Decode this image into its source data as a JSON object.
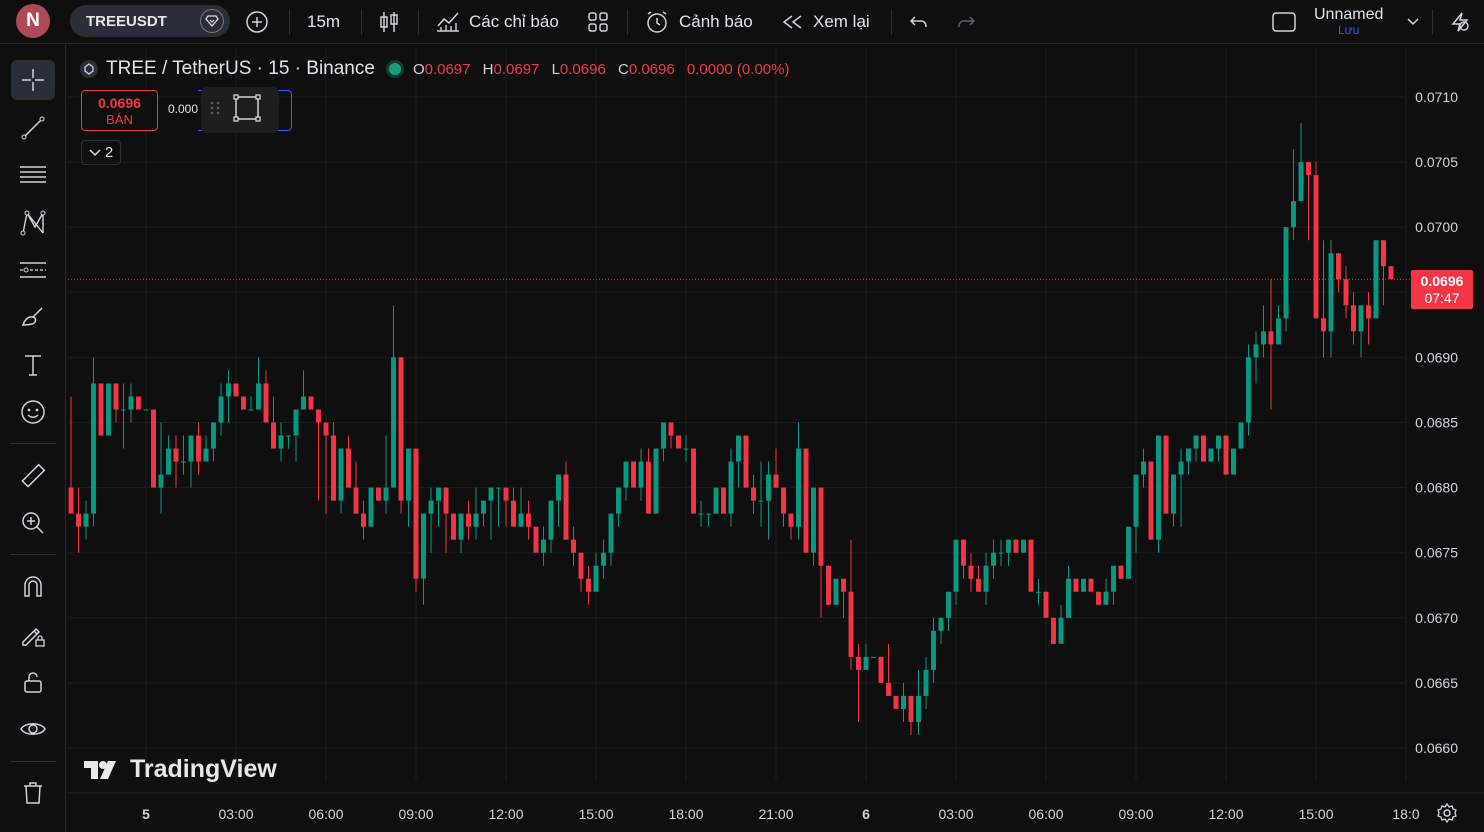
{
  "topbar": {
    "avatar_letter": "N",
    "symbol": "TREEUSDT",
    "interval": "15m",
    "indicators_label": "Các chỉ báo",
    "alerts_label": "Cảnh báo",
    "replay_label": "Xem lại",
    "layout_name": "Unnamed",
    "save_label": "Lưu"
  },
  "legend": {
    "title": "TREE / TetherUS · 15 · Binance",
    "o_key": "O",
    "o_val": "0.0697",
    "h_key": "H",
    "h_val": "0.0697",
    "l_key": "L",
    "l_val": "0.0696",
    "c_key": "C",
    "c_val": "0.0696",
    "change": "0.0000 (0.00%)"
  },
  "trade": {
    "sell_price": "0.0696",
    "sell_label": "BÁN",
    "spread": "0.000",
    "indicators_collapsed_count": "2"
  },
  "branding": {
    "logo_text": "TradingView"
  },
  "current_price": {
    "price": "0.0696",
    "countdown": "07:47"
  },
  "colors": {
    "up": "#089981",
    "down": "#f23645",
    "background": "#0f0f0f",
    "grid": "#1c1c1c",
    "accent": "#2962ff"
  },
  "left_tools": [
    "crosshair-icon",
    "trend-line-icon",
    "fib-levels-icon",
    "xabcd-pattern-icon",
    "forecast-icon",
    "brush-icon",
    "text-icon",
    "emoji-icon",
    "ruler-icon",
    "zoom-in-icon",
    "magnet-icon",
    "lock-drawing-icon",
    "lock-icon",
    "eye-icon",
    "trash-icon"
  ],
  "chart_data": {
    "type": "candlestick",
    "y_ticks": [
      "0.0710",
      "0.0705",
      "0.0700",
      "0.0695",
      "0.0690",
      "0.0685",
      "0.0680",
      "0.0675",
      "0.0670",
      "0.0665",
      "0.0660"
    ],
    "ylim": [
      0.06575,
      0.07135
    ],
    "x_ticks": [
      "5",
      "03:00",
      "06:00",
      "09:00",
      "12:00",
      "15:00",
      "18:00",
      "21:00",
      "6",
      "03:00",
      "06:00",
      "09:00",
      "12:00",
      "15:00",
      "18:0"
    ],
    "x_tick_hours_from_start": [
      0,
      3,
      6,
      9,
      12,
      15,
      18,
      21,
      24,
      27,
      30,
      33,
      36,
      39,
      42
    ],
    "bar_interval_minutes": 15,
    "first_bar_hours_offset": -2.5,
    "ohlc": [
      [
        0.068,
        0.0687,
        0.0678,
        0.0678
      ],
      [
        0.0678,
        0.068,
        0.0675,
        0.0677
      ],
      [
        0.0677,
        0.0679,
        0.0676,
        0.0678
      ],
      [
        0.0678,
        0.069,
        0.0677,
        0.0688
      ],
      [
        0.0688,
        0.0688,
        0.0684,
        0.0684
      ],
      [
        0.0684,
        0.0688,
        0.0684,
        0.0688
      ],
      [
        0.0688,
        0.0688,
        0.0685,
        0.0686
      ],
      [
        0.0686,
        0.0688,
        0.0683,
        0.0686
      ],
      [
        0.0686,
        0.0688,
        0.0685,
        0.0687
      ],
      [
        0.0687,
        0.0687,
        0.0686,
        0.0686
      ],
      [
        0.0686,
        0.0686,
        0.0686,
        0.0686
      ],
      [
        0.0686,
        0.0686,
        0.068,
        0.068
      ],
      [
        0.068,
        0.0685,
        0.0678,
        0.0681
      ],
      [
        0.0681,
        0.0684,
        0.0681,
        0.0683
      ],
      [
        0.0683,
        0.0684,
        0.068,
        0.0682
      ],
      [
        0.0682,
        0.0684,
        0.0681,
        0.0682
      ],
      [
        0.0682,
        0.0684,
        0.068,
        0.0684
      ],
      [
        0.0684,
        0.0685,
        0.0681,
        0.0682
      ],
      [
        0.0682,
        0.0684,
        0.0682,
        0.0683
      ],
      [
        0.0683,
        0.0685,
        0.0682,
        0.0685
      ],
      [
        0.0685,
        0.0688,
        0.0684,
        0.0687
      ],
      [
        0.0687,
        0.0689,
        0.0685,
        0.0688
      ],
      [
        0.0688,
        0.0687,
        0.0687,
        0.0687
      ],
      [
        0.0687,
        0.0687,
        0.0686,
        0.0686
      ],
      [
        0.0686,
        0.0687,
        0.0686,
        0.0686
      ],
      [
        0.0686,
        0.069,
        0.0686,
        0.0688
      ],
      [
        0.0688,
        0.0689,
        0.0685,
        0.0685
      ],
      [
        0.0685,
        0.0687,
        0.0683,
        0.0683
      ],
      [
        0.0683,
        0.0685,
        0.0682,
        0.0684
      ],
      [
        0.0684,
        0.0684,
        0.0683,
        0.0684
      ],
      [
        0.0684,
        0.0686,
        0.0682,
        0.0686
      ],
      [
        0.0686,
        0.0689,
        0.0686,
        0.0687
      ],
      [
        0.0687,
        0.0687,
        0.0686,
        0.0686
      ],
      [
        0.0686,
        0.0686,
        0.0679,
        0.0685
      ],
      [
        0.0685,
        0.0684,
        0.0678,
        0.0684
      ],
      [
        0.0684,
        0.0685,
        0.0679,
        0.0679
      ],
      [
        0.0679,
        0.0683,
        0.0678,
        0.0683
      ],
      [
        0.0683,
        0.0684,
        0.068,
        0.068
      ],
      [
        0.068,
        0.0682,
        0.0678,
        0.0678
      ],
      [
        0.0678,
        0.0679,
        0.0676,
        0.0677
      ],
      [
        0.0677,
        0.068,
        0.0677,
        0.068
      ],
      [
        0.068,
        0.0679,
        0.0679,
        0.0679
      ],
      [
        0.0679,
        0.0684,
        0.0678,
        0.068
      ],
      [
        0.068,
        0.0694,
        0.068,
        0.069
      ],
      [
        0.069,
        0.0689,
        0.0678,
        0.0679
      ],
      [
        0.0679,
        0.0683,
        0.0677,
        0.0683
      ],
      [
        0.0683,
        0.0678,
        0.0672,
        0.0673
      ],
      [
        0.0673,
        0.0678,
        0.0671,
        0.0678
      ],
      [
        0.0678,
        0.068,
        0.0675,
        0.0679
      ],
      [
        0.0679,
        0.068,
        0.0677,
        0.068
      ],
      [
        0.068,
        0.0679,
        0.0675,
        0.0678
      ],
      [
        0.0678,
        0.0678,
        0.0676,
        0.0676
      ],
      [
        0.0676,
        0.0678,
        0.0675,
        0.0678
      ],
      [
        0.0678,
        0.0679,
        0.0676,
        0.0677
      ],
      [
        0.0677,
        0.068,
        0.0676,
        0.0678
      ],
      [
        0.0678,
        0.0679,
        0.0677,
        0.0679
      ],
      [
        0.0679,
        0.068,
        0.0676,
        0.068
      ],
      [
        0.068,
        0.068,
        0.0677,
        0.068
      ],
      [
        0.068,
        0.068,
        0.0677,
        0.0679
      ],
      [
        0.0679,
        0.068,
        0.0677,
        0.0677
      ],
      [
        0.0677,
        0.068,
        0.0677,
        0.0678
      ],
      [
        0.0678,
        0.0679,
        0.0676,
        0.0677
      ],
      [
        0.0677,
        0.0676,
        0.0675,
        0.0675
      ],
      [
        0.0675,
        0.0677,
        0.0674,
        0.0676
      ],
      [
        0.0676,
        0.0679,
        0.0675,
        0.0679
      ],
      [
        0.0679,
        0.0681,
        0.0677,
        0.0681
      ],
      [
        0.0681,
        0.0682,
        0.0676,
        0.0676
      ],
      [
        0.0676,
        0.0677,
        0.0674,
        0.0675
      ],
      [
        0.0675,
        0.0674,
        0.0672,
        0.0673
      ],
      [
        0.0673,
        0.0674,
        0.0671,
        0.0672
      ],
      [
        0.0672,
        0.0675,
        0.0672,
        0.0674
      ],
      [
        0.0674,
        0.0676,
        0.0673,
        0.0675
      ],
      [
        0.0675,
        0.0678,
        0.0674,
        0.0678
      ],
      [
        0.0678,
        0.068,
        0.0677,
        0.068
      ],
      [
        0.068,
        0.0682,
        0.0679,
        0.0682
      ],
      [
        0.0682,
        0.0682,
        0.068,
        0.068
      ],
      [
        0.068,
        0.0683,
        0.0679,
        0.0682
      ],
      [
        0.0682,
        0.0683,
        0.0678,
        0.0678
      ],
      [
        0.0678,
        0.0683,
        0.0678,
        0.0683
      ],
      [
        0.0683,
        0.0685,
        0.0682,
        0.0685
      ],
      [
        0.0685,
        0.0685,
        0.0683,
        0.0684
      ],
      [
        0.0684,
        0.0684,
        0.0683,
        0.0683
      ],
      [
        0.0683,
        0.0684,
        0.0682,
        0.0683
      ],
      [
        0.0683,
        0.0683,
        0.0678,
        0.0678
      ],
      [
        0.0678,
        0.0679,
        0.0677,
        0.0678
      ],
      [
        0.0678,
        0.0678,
        0.0677,
        0.0678
      ],
      [
        0.0678,
        0.068,
        0.0678,
        0.068
      ],
      [
        0.068,
        0.068,
        0.0678,
        0.0678
      ],
      [
        0.0678,
        0.0683,
        0.0677,
        0.0682
      ],
      [
        0.0682,
        0.0684,
        0.068,
        0.0684
      ],
      [
        0.0684,
        0.0684,
        0.068,
        0.068
      ],
      [
        0.068,
        0.0681,
        0.0678,
        0.0679
      ],
      [
        0.0679,
        0.0682,
        0.0677,
        0.0679
      ],
      [
        0.0679,
        0.0682,
        0.0676,
        0.0681
      ],
      [
        0.0681,
        0.0683,
        0.068,
        0.068
      ],
      [
        0.068,
        0.068,
        0.0677,
        0.0678
      ],
      [
        0.0678,
        0.0677,
        0.0676,
        0.0677
      ],
      [
        0.0677,
        0.0685,
        0.0676,
        0.0683
      ],
      [
        0.0683,
        0.0683,
        0.0675,
        0.0675
      ],
      [
        0.0675,
        0.068,
        0.0674,
        0.068
      ],
      [
        0.068,
        0.0678,
        0.067,
        0.0674
      ],
      [
        0.0674,
        0.0674,
        0.0671,
        0.0671
      ],
      [
        0.0671,
        0.0673,
        0.0671,
        0.0673
      ],
      [
        0.0673,
        0.0672,
        0.067,
        0.0672
      ],
      [
        0.0672,
        0.0676,
        0.0666,
        0.0667
      ],
      [
        0.0667,
        0.0668,
        0.0662,
        0.0666
      ],
      [
        0.0666,
        0.0668,
        0.0666,
        0.0667
      ],
      [
        0.0667,
        0.0667,
        0.0667,
        0.0667
      ],
      [
        0.0667,
        0.0667,
        0.0665,
        0.0665
      ],
      [
        0.0665,
        0.0668,
        0.0664,
        0.0664
      ],
      [
        0.0664,
        0.0664,
        0.0663,
        0.0663
      ],
      [
        0.0663,
        0.0665,
        0.0662,
        0.0664
      ],
      [
        0.0664,
        0.0664,
        0.0661,
        0.0662
      ],
      [
        0.0662,
        0.0666,
        0.0661,
        0.0664
      ],
      [
        0.0664,
        0.0667,
        0.0663,
        0.0666
      ],
      [
        0.0666,
        0.067,
        0.0665,
        0.0669
      ],
      [
        0.0669,
        0.067,
        0.0668,
        0.067
      ],
      [
        0.067,
        0.0672,
        0.0669,
        0.0672
      ],
      [
        0.0672,
        0.0676,
        0.0671,
        0.0676
      ],
      [
        0.0676,
        0.0676,
        0.0673,
        0.0674
      ],
      [
        0.0674,
        0.0675,
        0.0672,
        0.0673
      ],
      [
        0.0673,
        0.0674,
        0.0672,
        0.0672
      ],
      [
        0.0672,
        0.0675,
        0.0671,
        0.0674
      ],
      [
        0.0674,
        0.0676,
        0.0673,
        0.0675
      ],
      [
        0.0675,
        0.0676,
        0.0674,
        0.0675
      ],
      [
        0.0675,
        0.0676,
        0.0674,
        0.0676
      ],
      [
        0.0676,
        0.0676,
        0.0675,
        0.0675
      ],
      [
        0.0675,
        0.0676,
        0.0675,
        0.0676
      ],
      [
        0.0676,
        0.0676,
        0.0672,
        0.0672
      ],
      [
        0.0672,
        0.0673,
        0.0671,
        0.0672
      ],
      [
        0.0672,
        0.0672,
        0.067,
        0.067
      ],
      [
        0.067,
        0.067,
        0.0668,
        0.0668
      ],
      [
        0.0668,
        0.0671,
        0.0668,
        0.067
      ],
      [
        0.067,
        0.0674,
        0.067,
        0.0673
      ],
      [
        0.0673,
        0.0673,
        0.0672,
        0.0672
      ],
      [
        0.0672,
        0.0673,
        0.0672,
        0.0673
      ],
      [
        0.0673,
        0.0672,
        0.0672,
        0.0672
      ],
      [
        0.0672,
        0.0672,
        0.0671,
        0.0671
      ],
      [
        0.0671,
        0.0673,
        0.0671,
        0.0672
      ],
      [
        0.0672,
        0.0674,
        0.0671,
        0.0674
      ],
      [
        0.0674,
        0.0674,
        0.0673,
        0.0673
      ],
      [
        0.0673,
        0.0677,
        0.0673,
        0.0677
      ],
      [
        0.0677,
        0.0681,
        0.0675,
        0.0681
      ],
      [
        0.0681,
        0.0683,
        0.068,
        0.0682
      ],
      [
        0.0682,
        0.0682,
        0.0676,
        0.0676
      ],
      [
        0.0676,
        0.0684,
        0.0675,
        0.0684
      ],
      [
        0.0684,
        0.0684,
        0.0678,
        0.0678
      ],
      [
        0.0678,
        0.0681,
        0.0677,
        0.0681
      ],
      [
        0.0681,
        0.0683,
        0.0677,
        0.0682
      ],
      [
        0.0682,
        0.0683,
        0.0681,
        0.0683
      ],
      [
        0.0683,
        0.0684,
        0.0682,
        0.0684
      ],
      [
        0.0684,
        0.0684,
        0.0682,
        0.0682
      ],
      [
        0.0682,
        0.0683,
        0.0682,
        0.0683
      ],
      [
        0.0683,
        0.0684,
        0.0682,
        0.0684
      ],
      [
        0.0684,
        0.0684,
        0.0681,
        0.0681
      ],
      [
        0.0681,
        0.0683,
        0.0681,
        0.0683
      ],
      [
        0.0683,
        0.0685,
        0.0683,
        0.0685
      ],
      [
        0.0685,
        0.0691,
        0.0684,
        0.069
      ],
      [
        0.069,
        0.0692,
        0.0688,
        0.0691
      ],
      [
        0.0691,
        0.0694,
        0.069,
        0.0692
      ],
      [
        0.0692,
        0.0696,
        0.0686,
        0.0691
      ],
      [
        0.0691,
        0.0694,
        0.0691,
        0.0693
      ],
      [
        0.0693,
        0.07,
        0.0692,
        0.07
      ],
      [
        0.07,
        0.0706,
        0.0699,
        0.0702
      ],
      [
        0.0702,
        0.0708,
        0.0703,
        0.0705
      ],
      [
        0.0705,
        0.0705,
        0.0699,
        0.0704
      ],
      [
        0.0704,
        0.0705,
        0.0693,
        0.0693
      ],
      [
        0.0693,
        0.0699,
        0.069,
        0.0692
      ],
      [
        0.0692,
        0.0699,
        0.069,
        0.0698
      ],
      [
        0.0698,
        0.0698,
        0.0695,
        0.0696
      ],
      [
        0.0696,
        0.0697,
        0.0693,
        0.0694
      ],
      [
        0.0694,
        0.0695,
        0.0691,
        0.0692
      ],
      [
        0.0692,
        0.0694,
        0.069,
        0.0694
      ],
      [
        0.0694,
        0.0695,
        0.0691,
        0.0693
      ],
      [
        0.0693,
        0.0699,
        0.0693,
        0.0699
      ],
      [
        0.0699,
        0.0699,
        0.0694,
        0.0697
      ],
      [
        0.0697,
        0.0697,
        0.0696,
        0.0696
      ]
    ]
  }
}
